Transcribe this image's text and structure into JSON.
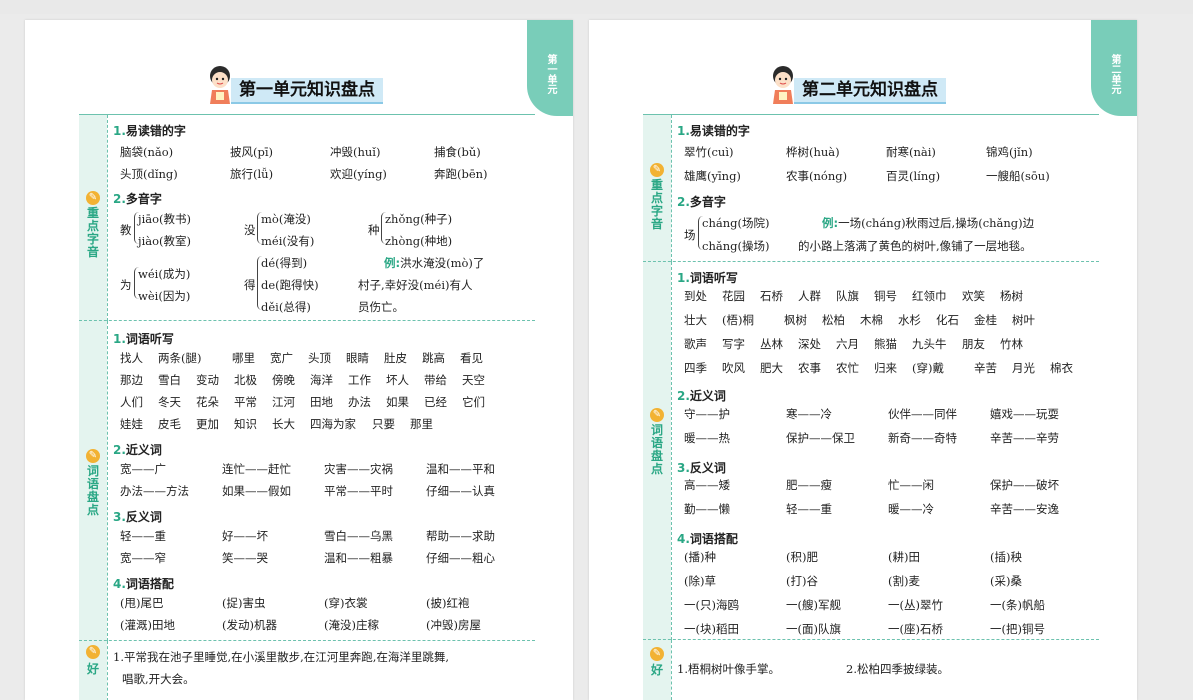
{
  "colors": {
    "accent": "#79cdb9",
    "label_green": "#2aa785",
    "title_bg": "#cfe9f6",
    "example_red": "#e1442c",
    "icon_orange": "#f2b233"
  },
  "left": {
    "tab": "第一单元",
    "title": "第一单元知识盘点",
    "sec1": {
      "label": "重点字音",
      "h1": "易读错的字",
      "h2": "多音字",
      "chars": [
        "脑袋(nǎo)",
        "披风(pī)",
        "冲毁(huǐ)",
        "捕食(bǔ)",
        "头顶(dǐng)",
        "旅行(lǚ)",
        "欢迎(yíng)",
        "奔跑(bēn)"
      ],
      "poly": {
        "c1": {
          "char": "教",
          "a": "jiāo(教书)",
          "b": "jiào(教室)"
        },
        "c2": {
          "char": "没",
          "a": "mò(淹没)",
          "b": "méi(没有)"
        },
        "c3": {
          "char": "种",
          "a": "zhǒng(种子)",
          "b": "zhòng(种地)"
        },
        "c4": {
          "char": "为",
          "a": "wéi(成为)",
          "b": "wèi(因为)"
        },
        "c5": {
          "char": "得",
          "a": "dé(得到)",
          "b": "de(跑得快)",
          "c": "děi(总得)"
        }
      },
      "example_label": "例:",
      "example": [
        "洪水淹没(mò)了",
        "村子,幸好没(méi)有人",
        "员伤亡。"
      ]
    },
    "sec2": {
      "label": "词语盘点",
      "h1": "词语听写",
      "h2": "近义词",
      "h3": "反义词",
      "h4": "词语搭配",
      "dictation": [
        [
          "找人",
          "两条(腿)",
          "哪里",
          "宽广",
          "头顶",
          "眼睛",
          "肚皮",
          "跳高",
          "看见"
        ],
        [
          "那边",
          "雪白",
          "变动",
          "北极",
          "傍晚",
          "海洋",
          "工作",
          "坏人",
          "带给",
          "天空"
        ],
        [
          "人们",
          "冬天",
          "花朵",
          "平常",
          "江河",
          "田地",
          "办法",
          "如果",
          "已经",
          "它们"
        ],
        [
          "娃娃",
          "皮毛",
          "更加",
          "知识",
          "长大",
          "四海为家",
          "只要",
          "那里"
        ]
      ],
      "synonyms": [
        "宽——广",
        "连忙——赶忙",
        "灾害——灾祸",
        "温和——平和",
        "办法——方法",
        "如果——假如",
        "平常——平时",
        "仔细——认真"
      ],
      "antonyms": [
        "轻——重",
        "好——坏",
        "雪白——乌黑",
        "帮助——求助",
        "宽——窄",
        "笑——哭",
        "温和——粗暴",
        "仔细——粗心"
      ],
      "collocations": [
        "(甩)尾巴",
        "(捉)害虫",
        "(穿)衣裳",
        "(披)红袍",
        "(灌溉)田地",
        "(发动)机器",
        "(淹没)庄稼",
        "(冲毁)房屋"
      ]
    },
    "sec3": {
      "label": "好",
      "line": "1.平常我在池子里睡觉,在小溪里散步,在江河里奔跑,在海洋里跳舞,",
      "line2": "唱歌,开大会。"
    }
  },
  "right": {
    "tab": "第二单元",
    "title": "第二单元知识盘点",
    "sec1": {
      "label": "重点字音",
      "h1": "易读错的字",
      "h2": "多音字",
      "chars": [
        "翠竹(cuì)",
        "桦树(huà)",
        "耐寒(nài)",
        "锦鸡(jǐn)",
        "雄鹰(yīng)",
        "农事(nóng)",
        "百灵(líng)",
        "一艘船(sōu)"
      ],
      "poly": {
        "char": "场",
        "a": "cháng(场院)",
        "b": "chǎng(操场)"
      },
      "example_label": "例:",
      "example1": "一场(cháng)秋雨过后,操场(chǎng)边",
      "example2": "的小路上落满了黄色的树叶,像铺了一层地毯。"
    },
    "sec2": {
      "label": "词语盘点",
      "h1": "词语听写",
      "h2": "近义词",
      "h3": "反义词",
      "h4": "词语搭配",
      "dictation": [
        [
          "到处",
          "花园",
          "石桥",
          "人群",
          "队旗",
          "铜号",
          "红领巾",
          "欢笑",
          "杨树"
        ],
        [
          "壮大",
          "(梧)桐",
          "枫树",
          "松柏",
          "木棉",
          "水杉",
          "化石",
          "金桂",
          "树叶"
        ],
        [
          "歌声",
          "写字",
          "丛林",
          "深处",
          "六月",
          "熊猫",
          "九头牛",
          "朋友",
          "竹林"
        ],
        [
          "四季",
          "吹风",
          "肥大",
          "农事",
          "农忙",
          "归来",
          "(穿)戴",
          "辛苦",
          "月光",
          "棉衣"
        ]
      ],
      "synonyms": [
        "守——护",
        "寒——冷",
        "伙伴——同伴",
        "嬉戏——玩耍",
        "暖——热",
        "保护——保卫",
        "新奇——奇特",
        "辛苦——辛劳"
      ],
      "antonyms": [
        "高——矮",
        "肥——瘦",
        "忙——闲",
        "保护——破坏",
        "勤——懒",
        "轻——重",
        "暖——冷",
        "辛苦——安逸"
      ],
      "collocations": [
        "(播)种",
        "(积)肥",
        "(耕)田",
        "(插)秧",
        "(除)草",
        "(打)谷",
        "(割)麦",
        "(采)桑",
        "一(只)海鸥",
        "一(艘)军舰",
        "一(丛)翠竹",
        "一(条)帆船",
        "一(块)稻田",
        "一(面)队旗",
        "一(座)石桥",
        "一(把)铜号"
      ]
    },
    "sec3": {
      "label": "好",
      "s1": "1.梧桐树叶像手掌。",
      "s2": "2.松柏四季披绿装。"
    }
  }
}
